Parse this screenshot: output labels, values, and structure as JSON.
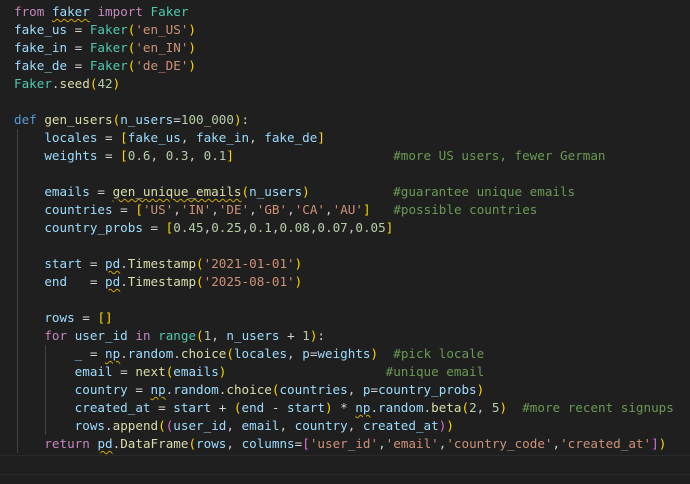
{
  "editor": {
    "lines": [
      [
        {
          "t": "from",
          "c": "kw"
        },
        {
          "t": " "
        },
        {
          "t": "faker",
          "c": "var",
          "sq": true
        },
        {
          "t": " "
        },
        {
          "t": "import",
          "c": "kw"
        },
        {
          "t": " "
        },
        {
          "t": "Faker",
          "c": "cls"
        }
      ],
      [
        {
          "t": "fake_us",
          "c": "var"
        },
        {
          "t": " = ",
          "c": "op"
        },
        {
          "t": "Faker",
          "c": "cls"
        },
        {
          "t": "(",
          "c": "br"
        },
        {
          "t": "'en_US'",
          "c": "str"
        },
        {
          "t": ")",
          "c": "br"
        }
      ],
      [
        {
          "t": "fake_in",
          "c": "var"
        },
        {
          "t": " = ",
          "c": "op"
        },
        {
          "t": "Faker",
          "c": "cls"
        },
        {
          "t": "(",
          "c": "br"
        },
        {
          "t": "'en_IN'",
          "c": "str"
        },
        {
          "t": ")",
          "c": "br"
        }
      ],
      [
        {
          "t": "fake_de",
          "c": "var"
        },
        {
          "t": " = ",
          "c": "op"
        },
        {
          "t": "Faker",
          "c": "cls"
        },
        {
          "t": "(",
          "c": "br"
        },
        {
          "t": "'de_DE'",
          "c": "str"
        },
        {
          "t": ")",
          "c": "br"
        }
      ],
      [
        {
          "t": "Faker",
          "c": "cls"
        },
        {
          "t": "."
        },
        {
          "t": "seed",
          "c": "fn"
        },
        {
          "t": "(",
          "c": "br"
        },
        {
          "t": "42",
          "c": "num"
        },
        {
          "t": ")",
          "c": "br"
        }
      ],
      [],
      [
        {
          "t": "def",
          "c": "def"
        },
        {
          "t": " "
        },
        {
          "t": "gen_users",
          "c": "fn"
        },
        {
          "t": "(",
          "c": "br"
        },
        {
          "t": "n_users",
          "c": "var"
        },
        {
          "t": "=",
          "c": "op"
        },
        {
          "t": "100_000",
          "c": "num"
        },
        {
          "t": ")",
          "c": "br"
        },
        {
          "t": ":"
        }
      ],
      [
        {
          "t": "    "
        },
        {
          "t": "locales",
          "c": "var"
        },
        {
          "t": " = ",
          "c": "op"
        },
        {
          "t": "[",
          "c": "br"
        },
        {
          "t": "fake_us",
          "c": "var"
        },
        {
          "t": ", "
        },
        {
          "t": "fake_in",
          "c": "var"
        },
        {
          "t": ", "
        },
        {
          "t": "fake_de",
          "c": "var"
        },
        {
          "t": "]",
          "c": "br"
        }
      ],
      [
        {
          "t": "    "
        },
        {
          "t": "weights",
          "c": "var"
        },
        {
          "t": " = ",
          "c": "op"
        },
        {
          "t": "[",
          "c": "br"
        },
        {
          "t": "0.6",
          "c": "num"
        },
        {
          "t": ", "
        },
        {
          "t": "0.3",
          "c": "num"
        },
        {
          "t": ", "
        },
        {
          "t": "0.1",
          "c": "num"
        },
        {
          "t": "]",
          "c": "br"
        },
        {
          "t": "                     "
        },
        {
          "t": "#more US users, fewer German",
          "c": "cm"
        }
      ],
      [],
      [
        {
          "t": "    "
        },
        {
          "t": "emails",
          "c": "var"
        },
        {
          "t": " = ",
          "c": "op"
        },
        {
          "t": "gen_unique_emails",
          "c": "fn",
          "sq": true
        },
        {
          "t": "(",
          "c": "br"
        },
        {
          "t": "n_users",
          "c": "var"
        },
        {
          "t": ")",
          "c": "br"
        },
        {
          "t": "           "
        },
        {
          "t": "#guarantee unique emails",
          "c": "cm"
        }
      ],
      [
        {
          "t": "    "
        },
        {
          "t": "countries",
          "c": "var"
        },
        {
          "t": " = ",
          "c": "op"
        },
        {
          "t": "[",
          "c": "br"
        },
        {
          "t": "'US'",
          "c": "str"
        },
        {
          "t": ","
        },
        {
          "t": "'IN'",
          "c": "str"
        },
        {
          "t": ","
        },
        {
          "t": "'DE'",
          "c": "str"
        },
        {
          "t": ","
        },
        {
          "t": "'GB'",
          "c": "str"
        },
        {
          "t": ","
        },
        {
          "t": "'CA'",
          "c": "str"
        },
        {
          "t": ","
        },
        {
          "t": "'AU'",
          "c": "str"
        },
        {
          "t": "]",
          "c": "br"
        },
        {
          "t": "   "
        },
        {
          "t": "#possible countries",
          "c": "cm"
        }
      ],
      [
        {
          "t": "    "
        },
        {
          "t": "country_probs",
          "c": "var"
        },
        {
          "t": " = ",
          "c": "op"
        },
        {
          "t": "[",
          "c": "br"
        },
        {
          "t": "0.45",
          "c": "num"
        },
        {
          "t": ","
        },
        {
          "t": "0.25",
          "c": "num"
        },
        {
          "t": ","
        },
        {
          "t": "0.1",
          "c": "num"
        },
        {
          "t": ","
        },
        {
          "t": "0.08",
          "c": "num"
        },
        {
          "t": ","
        },
        {
          "t": "0.07",
          "c": "num"
        },
        {
          "t": ","
        },
        {
          "t": "0.05",
          "c": "num"
        },
        {
          "t": "]",
          "c": "br"
        }
      ],
      [],
      [
        {
          "t": "    "
        },
        {
          "t": "start",
          "c": "var"
        },
        {
          "t": " = ",
          "c": "op"
        },
        {
          "t": "pd",
          "c": "var",
          "sq": true
        },
        {
          "t": "."
        },
        {
          "t": "Timestamp",
          "c": "fn"
        },
        {
          "t": "(",
          "c": "br"
        },
        {
          "t": "'2021-01-01'",
          "c": "str"
        },
        {
          "t": ")",
          "c": "br"
        }
      ],
      [
        {
          "t": "    "
        },
        {
          "t": "end",
          "c": "var"
        },
        {
          "t": "   = ",
          "c": "op"
        },
        {
          "t": "pd",
          "c": "var",
          "sq": true
        },
        {
          "t": "."
        },
        {
          "t": "Timestamp",
          "c": "fn"
        },
        {
          "t": "(",
          "c": "br"
        },
        {
          "t": "'2025-08-01'",
          "c": "str"
        },
        {
          "t": ")",
          "c": "br"
        }
      ],
      [],
      [
        {
          "t": "    "
        },
        {
          "t": "rows",
          "c": "var"
        },
        {
          "t": " = ",
          "c": "op"
        },
        {
          "t": "[]",
          "c": "br"
        }
      ],
      [
        {
          "t": "    "
        },
        {
          "t": "for",
          "c": "kw"
        },
        {
          "t": " "
        },
        {
          "t": "user_id",
          "c": "var"
        },
        {
          "t": " "
        },
        {
          "t": "in",
          "c": "kw"
        },
        {
          "t": " "
        },
        {
          "t": "range",
          "c": "cls"
        },
        {
          "t": "(",
          "c": "br"
        },
        {
          "t": "1",
          "c": "num"
        },
        {
          "t": ", "
        },
        {
          "t": "n_users",
          "c": "var"
        },
        {
          "t": " + ",
          "c": "op"
        },
        {
          "t": "1",
          "c": "num"
        },
        {
          "t": ")",
          "c": "br"
        },
        {
          "t": ":"
        }
      ],
      [
        {
          "t": "        "
        },
        {
          "t": "_",
          "c": "var"
        },
        {
          "t": " = ",
          "c": "op"
        },
        {
          "t": "np",
          "c": "var",
          "sq": true
        },
        {
          "t": "."
        },
        {
          "t": "random",
          "c": "var"
        },
        {
          "t": "."
        },
        {
          "t": "choice",
          "c": "fn"
        },
        {
          "t": "(",
          "c": "br"
        },
        {
          "t": "locales",
          "c": "var"
        },
        {
          "t": ", "
        },
        {
          "t": "p",
          "c": "var"
        },
        {
          "t": "=",
          "c": "op"
        },
        {
          "t": "weights",
          "c": "var"
        },
        {
          "t": ")",
          "c": "br"
        },
        {
          "t": "  "
        },
        {
          "t": "#pick locale",
          "c": "cm"
        }
      ],
      [
        {
          "t": "        "
        },
        {
          "t": "email",
          "c": "var"
        },
        {
          "t": " = ",
          "c": "op"
        },
        {
          "t": "next",
          "c": "fn"
        },
        {
          "t": "(",
          "c": "br"
        },
        {
          "t": "emails",
          "c": "var"
        },
        {
          "t": ")",
          "c": "br"
        },
        {
          "t": "                     "
        },
        {
          "t": "#unique email",
          "c": "cm"
        }
      ],
      [
        {
          "t": "        "
        },
        {
          "t": "country",
          "c": "var"
        },
        {
          "t": " = ",
          "c": "op"
        },
        {
          "t": "np",
          "c": "var",
          "sq": true
        },
        {
          "t": "."
        },
        {
          "t": "random",
          "c": "var"
        },
        {
          "t": "."
        },
        {
          "t": "choice",
          "c": "fn"
        },
        {
          "t": "(",
          "c": "br"
        },
        {
          "t": "countries",
          "c": "var"
        },
        {
          "t": ", "
        },
        {
          "t": "p",
          "c": "var"
        },
        {
          "t": "=",
          "c": "op"
        },
        {
          "t": "country_probs",
          "c": "var"
        },
        {
          "t": ")",
          "c": "br"
        }
      ],
      [
        {
          "t": "        "
        },
        {
          "t": "created_at",
          "c": "var"
        },
        {
          "t": " = ",
          "c": "op"
        },
        {
          "t": "start",
          "c": "var"
        },
        {
          "t": " + ",
          "c": "op"
        },
        {
          "t": "(",
          "c": "br"
        },
        {
          "t": "end",
          "c": "var"
        },
        {
          "t": " - ",
          "c": "op"
        },
        {
          "t": "start",
          "c": "var"
        },
        {
          "t": ")",
          "c": "br"
        },
        {
          "t": " * ",
          "c": "op"
        },
        {
          "t": "np",
          "c": "var",
          "sq": true
        },
        {
          "t": "."
        },
        {
          "t": "random",
          "c": "var"
        },
        {
          "t": "."
        },
        {
          "t": "beta",
          "c": "fn"
        },
        {
          "t": "(",
          "c": "br"
        },
        {
          "t": "2",
          "c": "num"
        },
        {
          "t": ", "
        },
        {
          "t": "5",
          "c": "num"
        },
        {
          "t": ")",
          "c": "br"
        },
        {
          "t": "  "
        },
        {
          "t": "#more recent signups",
          "c": "cm"
        }
      ],
      [
        {
          "t": "        "
        },
        {
          "t": "rows",
          "c": "var"
        },
        {
          "t": "."
        },
        {
          "t": "append",
          "c": "fn"
        },
        {
          "t": "(",
          "c": "br"
        },
        {
          "t": "(",
          "c": "br2"
        },
        {
          "t": "user_id",
          "c": "var"
        },
        {
          "t": ", "
        },
        {
          "t": "email",
          "c": "var"
        },
        {
          "t": ", "
        },
        {
          "t": "country",
          "c": "var"
        },
        {
          "t": ", "
        },
        {
          "t": "created_at",
          "c": "var"
        },
        {
          "t": ")",
          "c": "br2"
        },
        {
          "t": ")",
          "c": "br"
        }
      ],
      [
        {
          "t": "    "
        },
        {
          "t": "return",
          "c": "kw"
        },
        {
          "t": " "
        },
        {
          "t": "pd",
          "c": "var",
          "sq": true
        },
        {
          "t": "."
        },
        {
          "t": "DataFrame",
          "c": "fn"
        },
        {
          "t": "(",
          "c": "br"
        },
        {
          "t": "rows",
          "c": "var"
        },
        {
          "t": ", "
        },
        {
          "t": "columns",
          "c": "var"
        },
        {
          "t": "=",
          "c": "op"
        },
        {
          "t": "[",
          "c": "br2"
        },
        {
          "t": "'user_id'",
          "c": "str"
        },
        {
          "t": ","
        },
        {
          "t": "'email'",
          "c": "str"
        },
        {
          "t": ","
        },
        {
          "t": "'country_code'",
          "c": "str"
        },
        {
          "t": ","
        },
        {
          "t": "'created_at'",
          "c": "str"
        },
        {
          "t": "]",
          "c": "br2"
        },
        {
          "t": ")",
          "c": "br"
        }
      ],
      []
    ],
    "indent_guides": [
      [],
      [],
      [],
      [],
      [],
      [],
      [],
      [
        1
      ],
      [
        1
      ],
      [
        1
      ],
      [
        1
      ],
      [
        1
      ],
      [
        1
      ],
      [
        1
      ],
      [
        1
      ],
      [
        1
      ],
      [
        1
      ],
      [
        1
      ],
      [
        1
      ],
      [
        1,
        2
      ],
      [
        1,
        2
      ],
      [
        1,
        2
      ],
      [
        1,
        2
      ],
      [
        1,
        2
      ],
      [
        1
      ],
      []
    ]
  }
}
